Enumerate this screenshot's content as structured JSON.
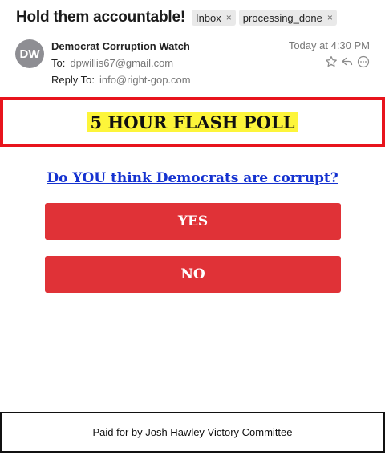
{
  "email": {
    "subject": "Hold them accountable!",
    "tags": [
      "Inbox",
      "processing_done"
    ],
    "tag_remove_glyph": "×",
    "avatar_initials": "DW",
    "sender_name": "Democrat Corruption Watch",
    "to_label": "To:",
    "to_address": "dpwillis67@gmail.com",
    "reply_to_label": "Reply To:",
    "reply_to_address": "info@right-gop.com",
    "date": "Today at 4:30 PM",
    "action_icons": [
      "star-icon",
      "reply-icon",
      "more-icon"
    ]
  },
  "body": {
    "flash_title": "5 HOUR FLASH POLL",
    "question": "Do YOU think Democrats are corrupt?",
    "yes_label": "YES",
    "no_label": "NO",
    "footer": "Paid for by Josh Hawley Victory Committee"
  },
  "colors": {
    "flash_border": "#e8141c",
    "flash_highlight": "#fdf53a",
    "question_link": "#1532d0",
    "button_red": "#e03237",
    "avatar_gray": "#8e8e93"
  }
}
